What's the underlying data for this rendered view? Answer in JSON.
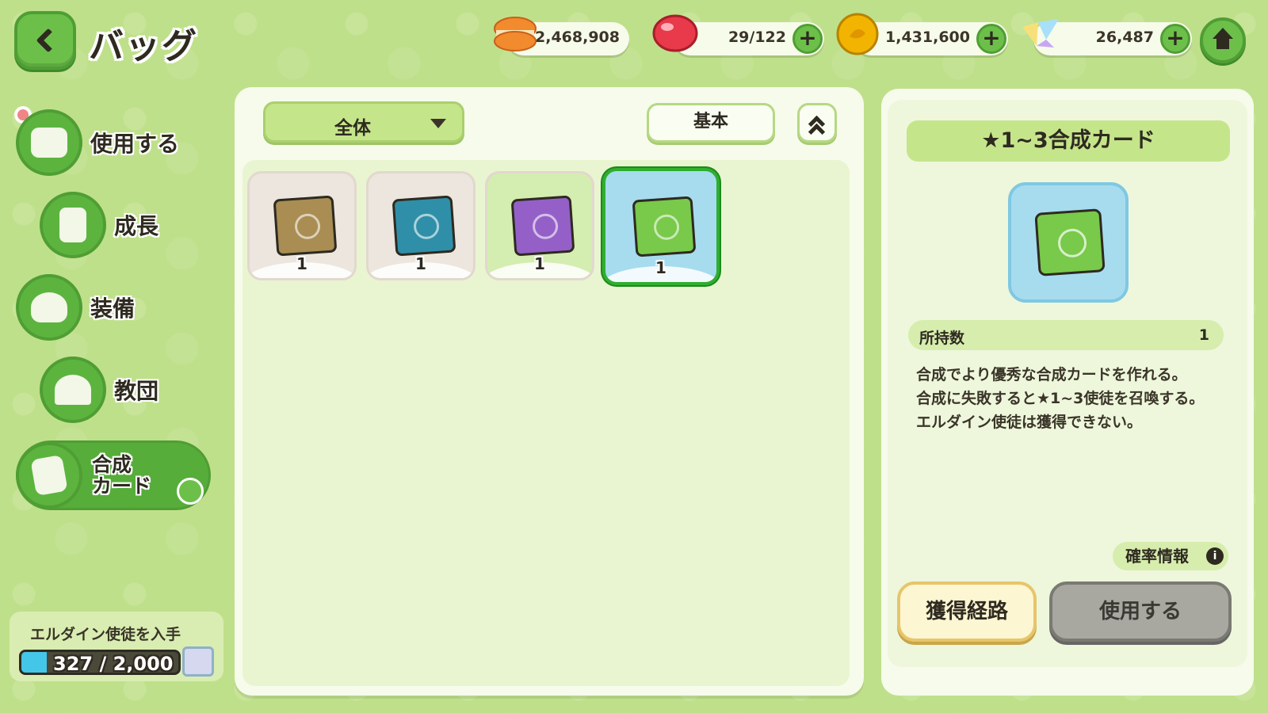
{
  "header": {
    "title": "バッグ"
  },
  "resources": [
    {
      "value": "2,468,908",
      "icon": "macaron-icon",
      "color": "#f28a2e"
    },
    {
      "value": "29/122",
      "icon": "candy-icon",
      "color": "#e83a4a"
    },
    {
      "value": "1,431,600",
      "icon": "gold-coin-icon",
      "color": "#f2b400"
    },
    {
      "value": "26,487",
      "icon": "crystal-icon",
      "color": "#9fd8f2"
    }
  ],
  "nav": {
    "items": [
      {
        "label": "使用する",
        "icon": "chest-icon"
      },
      {
        "label": "成長",
        "icon": "potion-icon"
      },
      {
        "label": "装備",
        "icon": "equipment-icon"
      },
      {
        "label": "教団",
        "icon": "temple-icon"
      },
      {
        "label": "合成\nカード",
        "icon": "card-icon",
        "active": true
      }
    ]
  },
  "gauge": {
    "title": "エルダイン使徒を入手",
    "text": "327 / 2,000",
    "fraction": 0.1635
  },
  "filters": {
    "category": "全体",
    "sort": "基本"
  },
  "cards": [
    {
      "count": "1",
      "color": "#a98d52",
      "slot_bg": "#ece6de"
    },
    {
      "count": "1",
      "color": "#2f8fa8",
      "slot_bg": "#ece6de"
    },
    {
      "count": "1",
      "color": "#9460c8",
      "slot_bg": "#d4edb0"
    },
    {
      "count": "1",
      "color": "#79c94a",
      "slot_bg": "#a7dcef",
      "selected": true
    }
  ],
  "detail": {
    "title": "★1~3合成カード",
    "owned_label": "所持数",
    "owned_value": "1",
    "description": [
      "合成でより優秀な合成カードを作れる。",
      "合成に失敗すると★1~3使徒を召喚する。",
      "エルダイン使徒は獲得できない。"
    ],
    "probability_label": "確率情報",
    "source_button": "獲得経路",
    "use_button": "使用する"
  }
}
